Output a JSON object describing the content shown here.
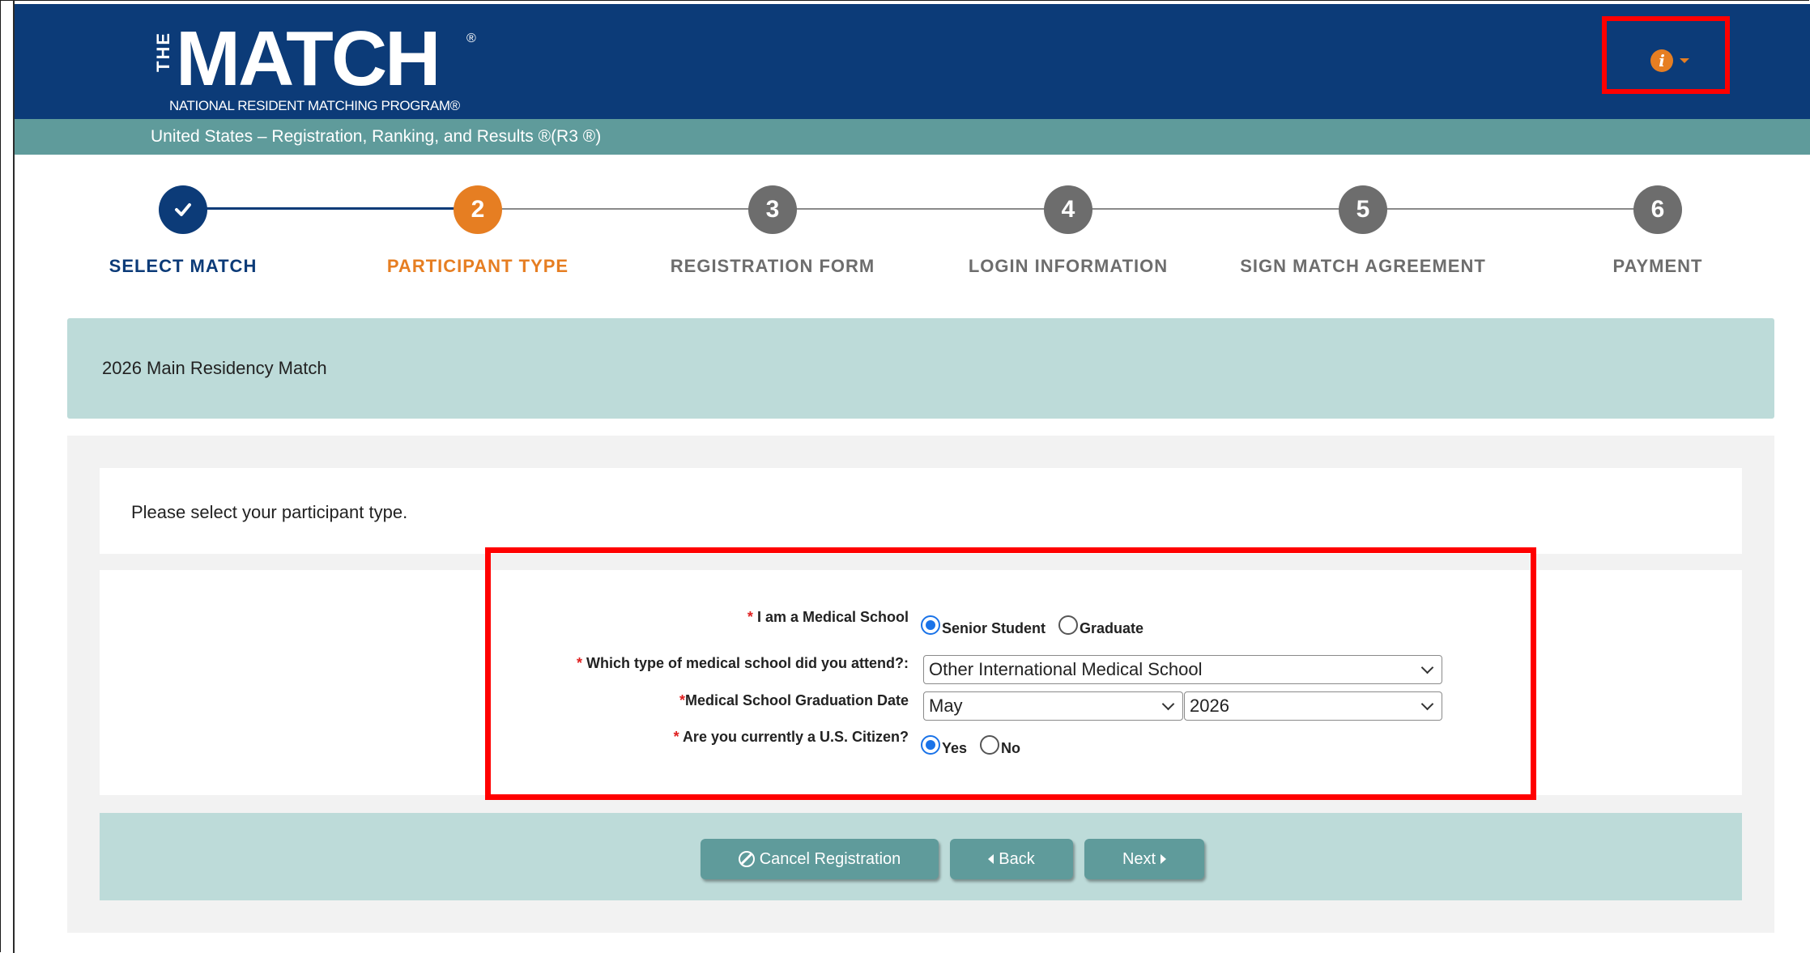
{
  "header": {
    "logo_the": "THE",
    "logo_word": "MATCH",
    "logo_reg": "®",
    "logo_subtitle": "NATIONAL RESIDENT MATCHING PROGRAM®",
    "info_icon": "info-circle-icon"
  },
  "subbar": {
    "text": "United States  –  Registration, Ranking, and Results ®(R3 ®)"
  },
  "steps": [
    {
      "number": "✓",
      "label": "SELECT MATCH",
      "state": "done"
    },
    {
      "number": "2",
      "label": "PARTICIPANT TYPE",
      "state": "active"
    },
    {
      "number": "3",
      "label": "REGISTRATION FORM",
      "state": "pending"
    },
    {
      "number": "4",
      "label": "LOGIN INFORMATION",
      "state": "pending"
    },
    {
      "number": "5",
      "label": "SIGN MATCH AGREEMENT",
      "state": "pending"
    },
    {
      "number": "6",
      "label": "PAYMENT",
      "state": "pending"
    }
  ],
  "match_banner": {
    "text": "2026 Main Residency Match"
  },
  "prompt": {
    "text": "Please select your participant type."
  },
  "form": {
    "medical_school": {
      "required": "* ",
      "label": "I am a Medical School",
      "options": [
        {
          "label": "Senior Student",
          "selected": true
        },
        {
          "label": "Graduate",
          "selected": false
        }
      ]
    },
    "school_type": {
      "required": "* ",
      "label": "Which type of medical school did you attend?:",
      "value": "Other International Medical School"
    },
    "graduation_date": {
      "required": "*",
      "label": "Medical School Graduation Date",
      "month": "May",
      "year": "2026"
    },
    "citizen": {
      "required": "* ",
      "label": "Are you currently a U.S. Citizen?",
      "options": [
        {
          "label": "Yes",
          "selected": true
        },
        {
          "label": "No",
          "selected": false
        }
      ]
    }
  },
  "buttons": {
    "cancel": "Cancel Registration",
    "back": "Back",
    "next": "Next"
  },
  "colors": {
    "brand_navy": "#0c3b78",
    "accent_orange": "#e67e22",
    "teal": "#5f9b9b",
    "light_teal": "#bddbd9",
    "highlight_red": "#ff0000"
  }
}
